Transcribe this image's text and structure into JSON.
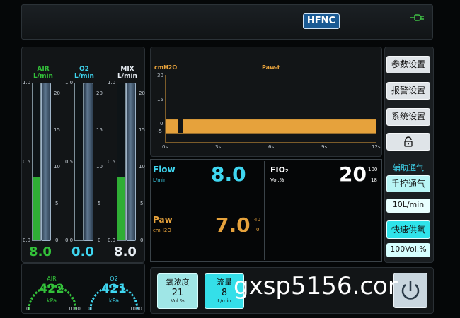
{
  "header": {
    "mode": "HFNC",
    "power_icon": "plug-icon"
  },
  "flowmeters": {
    "air": {
      "name": "AIR",
      "unit": "L/min",
      "value": "8.0",
      "fill": 0.4,
      "color": "#33c23a"
    },
    "o2": {
      "name": "O2",
      "unit": "L/min",
      "value": "0.0",
      "fill": 0.0,
      "color": "#3fd6f0"
    },
    "mix": {
      "name": "MIX",
      "unit": "L/min",
      "value": "8.0",
      "fill": 0.4,
      "color": "#e8eef4"
    },
    "left_ticks": [
      "1.0",
      "0.5",
      "0.0"
    ],
    "right_ticks": [
      "20",
      "15",
      "10",
      "5",
      "0"
    ]
  },
  "pressure_gauges": {
    "air": {
      "name": "AIR",
      "value": "422",
      "unit": "kPa",
      "min": "0",
      "max": "1000"
    },
    "o2": {
      "name": "O2",
      "value": "421",
      "unit": "kPa",
      "min": "0",
      "max": "1000"
    }
  },
  "waveform": {
    "title": "Paw-t",
    "ylabel": "cmH2O",
    "y_ticks": [
      "30",
      "15",
      "0",
      "-5"
    ],
    "x_ticks": [
      "0s",
      "3s",
      "6s",
      "9s",
      "12s"
    ],
    "color": "#e6a23c"
  },
  "values": {
    "flow": {
      "label": "Flow",
      "unit": "L/min",
      "value": "8.0"
    },
    "paw": {
      "label": "Paw",
      "unit": "cmH2O",
      "value": "7.0",
      "high": "40",
      "low": "0"
    },
    "fio2": {
      "label": "FIO",
      "sub": "2",
      "unit": "Vol.%",
      "value": "20",
      "high": "100",
      "low": "18"
    }
  },
  "menu": {
    "param_settings": "参数设置",
    "alarm_settings": "报警设置",
    "system_settings": "系统设置",
    "lock_icon": "lock-icon",
    "assist_title": "辅助通气",
    "manual_vent": "手控通气",
    "manual_flow": "10L/min",
    "rapid_o2": "快速供氧",
    "rapid_o2_value": "100Vol.%"
  },
  "bottom": {
    "o2_conc": {
      "label": "氧浓度",
      "value": "21",
      "unit": "Vol.%"
    },
    "flow": {
      "label": "流量",
      "value": "8",
      "unit": "L/min"
    },
    "watermark": "gxsp5156.cor"
  },
  "chart_data": {
    "type": "area",
    "title": "Paw-t",
    "ylabel": "cmH2O",
    "xlabel": "",
    "x": [
      0,
      0.7,
      0.7,
      12
    ],
    "y": [
      7,
      7,
      0,
      7
    ],
    "xlim": [
      0,
      12
    ],
    "ylim": [
      -5,
      30
    ],
    "series": [
      {
        "values": [
          7,
          7,
          7,
          7
        ]
      }
    ]
  }
}
